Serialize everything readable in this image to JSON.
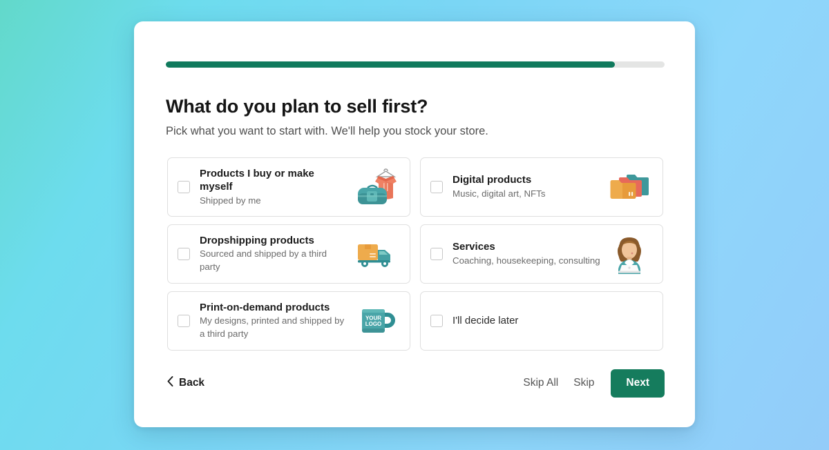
{
  "progress": {
    "percent": 90,
    "fill_color": "#107a5d",
    "track_color": "#e4e5e4"
  },
  "heading": {
    "title": "What do you plan to sell first?",
    "subtitle": "Pick what you want to start with. We'll help you stock your store."
  },
  "options": [
    {
      "title": "Products I buy or make myself",
      "subtitle": "Shipped by me",
      "icon": "bag-and-sweater-icon",
      "checked": false
    },
    {
      "title": "Digital products",
      "subtitle": "Music, digital art, NFTs",
      "icon": "folders-icon",
      "checked": false
    },
    {
      "title": "Dropshipping products",
      "subtitle": "Sourced and shipped by a third party",
      "icon": "delivery-truck-icon",
      "checked": false
    },
    {
      "title": "Services",
      "subtitle": "Coaching, housekeeping, consulting",
      "icon": "person-with-laptop-icon",
      "checked": false
    },
    {
      "title": "Print-on-demand products",
      "subtitle": "My designs, printed and shipped by a third party",
      "icon": "logo-mug-icon",
      "checked": false
    },
    {
      "title": "I'll decide later",
      "subtitle": "",
      "icon": "",
      "checked": false
    }
  ],
  "mug_label": {
    "line1": "YOUR",
    "line2": "LOGO"
  },
  "footer": {
    "back_label": "Back",
    "skip_all_label": "Skip All",
    "skip_label": "Skip",
    "next_label": "Next",
    "next_color": "#157c5d"
  },
  "background": {
    "top_left": "#6ddcee",
    "bottom_left": "#62d9ca",
    "right": "#93ccf9"
  }
}
